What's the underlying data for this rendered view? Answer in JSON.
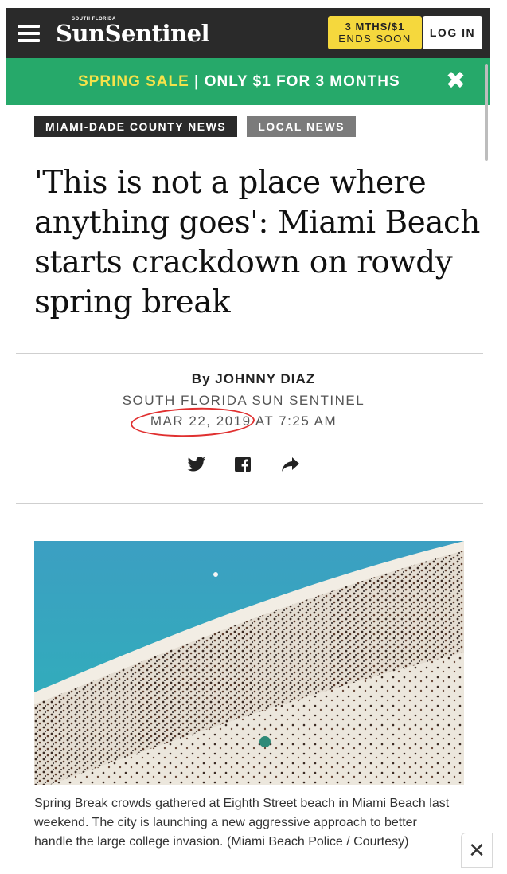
{
  "header": {
    "logo_small": "SOUTH FLORIDA",
    "logo": "SunSentinel",
    "promo_line1": "3 MTHS/$1",
    "promo_line2": "ENDS SOON",
    "login": "LOG IN",
    "menu_icon": "hamburger-icon"
  },
  "banner": {
    "sale": "SPRING SALE",
    "separator": " | ",
    "offer": "ONLY $1 FOR 3 MONTHS",
    "close": "✖"
  },
  "tags": [
    "MIAMI-DADE COUNTY NEWS",
    "LOCAL NEWS"
  ],
  "article": {
    "headline": "'This is not a place where anything goes': Miami Beach starts crackdown on rowdy spring break",
    "byline": "By JOHNNY DIAZ",
    "source": "SOUTH FLORIDA SUN SENTINEL",
    "date": "MAR 22, 2019 AT 7:25 AM",
    "caption": "Spring Break crowds gathered at Eighth Street beach in Miami Beach last weekend. The city is launching a new aggressive approach to better handle the large college invasion. (Miami Beach Police / Courtesy)",
    "caption_close": "✕"
  },
  "share_icons": [
    "twitter-icon",
    "facebook-icon",
    "share-icon"
  ],
  "colors": {
    "header_bg": "#2a2a2a",
    "banner_bg": "#26a96a",
    "accent_yellow": "#f5d83d",
    "annotation_red": "#e03030"
  }
}
